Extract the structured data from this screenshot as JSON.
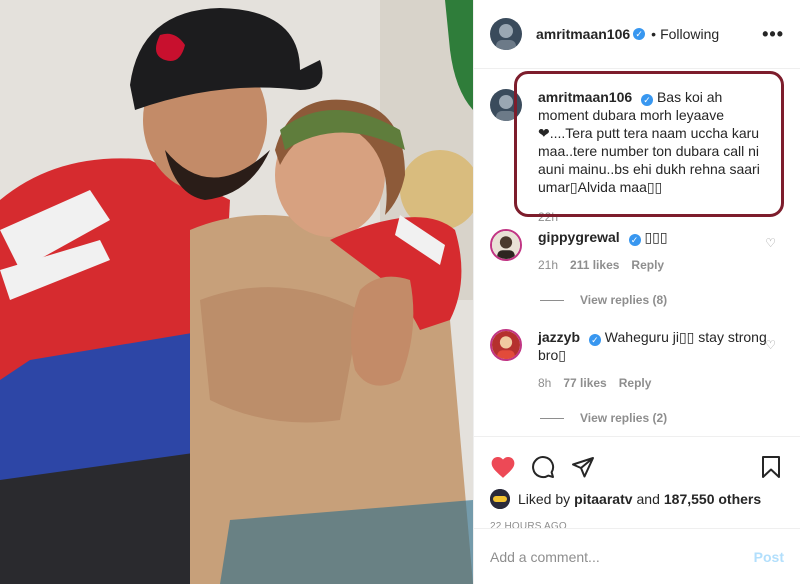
{
  "post": {
    "username": "amritmaan106",
    "verified_mark": "✓",
    "separator": "•",
    "follow_status": "Following",
    "more_label": "•••"
  },
  "caption": {
    "username": "amritmaan106",
    "text": "Bas koi ah moment dubara morh leyaave❤....Tera putt tera naam uccha karu maa..tere number ton dubara call ni auni mainu..bs ehi dukh rehna saari umar▯Alvida maa▯▯",
    "time": "22h"
  },
  "comments": [
    {
      "username": "gippygrewal",
      "text": "▯▯▯",
      "time": "21h",
      "likes": "211 likes",
      "reply_label": "Reply",
      "view_replies": "View replies (8)"
    },
    {
      "username": "jazzyb",
      "text": "Waheguru ji▯▯ stay strong bro▯",
      "time": "8h",
      "likes": "77 likes",
      "reply_label": "Reply",
      "view_replies": "View replies (2)"
    }
  ],
  "likes_line": {
    "prefix": "Liked by ",
    "user": "pitaaratv",
    "middle": " and ",
    "count": "187,550 others"
  },
  "timestamp": "22 HOURS AGO",
  "add_comment": {
    "placeholder": "Add a comment...",
    "post_label": "Post"
  },
  "colors": {
    "heart_liked": "#ed4956",
    "verified": "#3897f0",
    "highlight_box": "#7d1d2c",
    "post_disabled": "#b2dffc"
  },
  "icons": [
    "heart-icon",
    "comment-icon",
    "share-icon",
    "bookmark-icon",
    "like-heart-icon"
  ]
}
